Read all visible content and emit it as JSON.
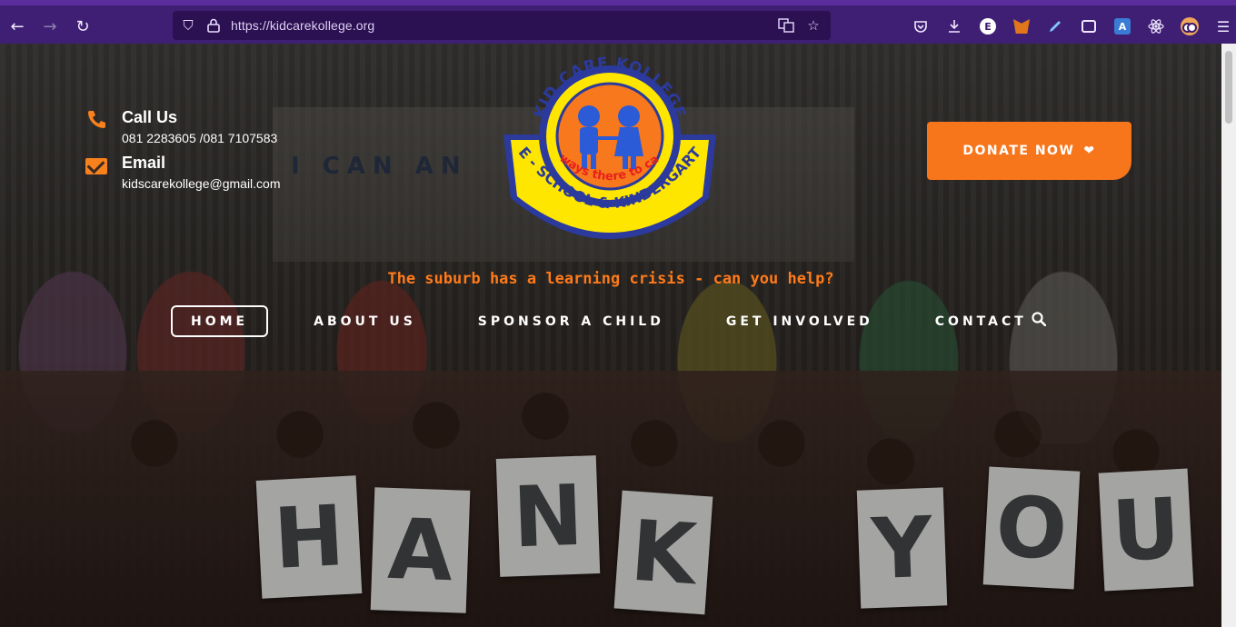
{
  "browser": {
    "url": "https://kidcarekollege.org",
    "ext_badge": "E",
    "translate_badge": "A"
  },
  "contact": {
    "call_title": "Call Us",
    "call_value": "081 2283605 /081 7107583",
    "email_title": "Email",
    "email_value": "kidscarekollege@gmail.com"
  },
  "logo": {
    "name": "KID CARE KOLLEGE",
    "motto": "always there to care",
    "subtitle": "PRE - SCHOOL & KINDERGARTEN"
  },
  "donate": {
    "label": "DONATE NOW"
  },
  "tagline": "The suburb has a learning crisis - can you help?",
  "nav": [
    {
      "label": "HOME",
      "active": true
    },
    {
      "label": "ABOUT US"
    },
    {
      "label": "SPONSOR A CHILD"
    },
    {
      "label": "GET INVOLVED"
    },
    {
      "label": "CONTACT"
    }
  ],
  "photo": {
    "wall_text": "I CAN AN",
    "letters": [
      "H",
      "A",
      "N",
      "K",
      "Y",
      "O",
      "U"
    ]
  },
  "colors": {
    "accent": "#f7761b",
    "browser_toolbar": "#3f1f73",
    "logo_blue": "#2b3a9c",
    "logo_yellow": "#ffe600"
  }
}
